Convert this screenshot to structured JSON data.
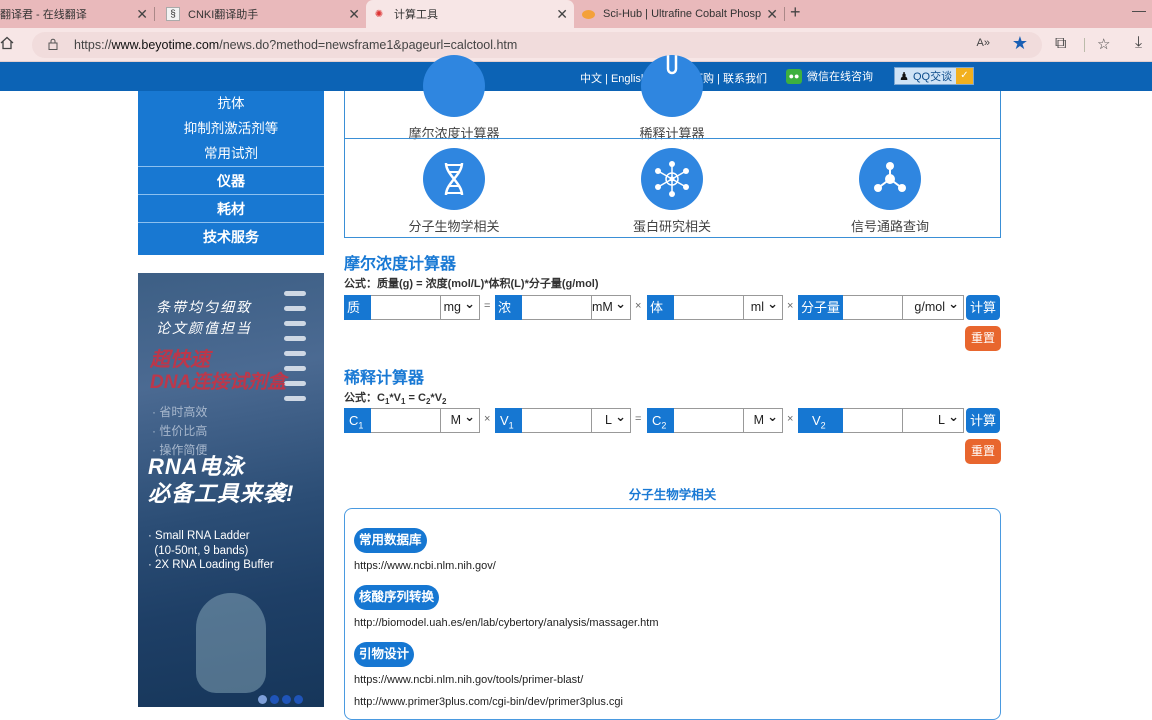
{
  "browser": {
    "tabs": [
      {
        "title": "翻译君 - 在线翻译",
        "active": false
      },
      {
        "title": "CNKI翻译助手",
        "active": false
      },
      {
        "title": "计算工具",
        "active": true
      },
      {
        "title": "Sci-Hub | Ultrafine Cobalt Phosp",
        "active": false
      }
    ],
    "url_prefix": "https://",
    "url_domain": "www.beyotime.com",
    "url_path": "/news.do?method=newsframe1&pageurl=calctool.htm",
    "read_aloud": "A»"
  },
  "topnav": {
    "lang": "中文 | English",
    "order": "快速订购 | 联系我们",
    "wechat": "微信在线咨询",
    "qq": "QQ交谈"
  },
  "sidebar": {
    "sub_items": [
      "抗体",
      "抑制剂激活剂等",
      "常用试剂"
    ],
    "main_items": [
      "仪器",
      "耗材",
      "技术服务"
    ]
  },
  "ad": {
    "line1": "条带均匀细致",
    "line2": "论文颜值担当",
    "headline1": "超快速",
    "headline2": "DNA连接试剂盒",
    "bullets": [
      "· 省时高效",
      "· 性价比高",
      "· 操作简便"
    ],
    "big1": "RNA电泳",
    "big2": "必备工具来袭!",
    "en1": "· Small RNA Ladder",
    "en2": "  (10-50nt, 9 bands)",
    "en3": "· 2X RNA Loading Buffer"
  },
  "categories": {
    "molar": "摩尔浓度计算器",
    "dilution": "稀释计算器",
    "molbio": "分子生物学相关",
    "protein": "蛋白研究相关",
    "signal": "信号通路查询"
  },
  "molar_calc": {
    "title": "摩尔浓度计算器",
    "formula": "公式：质量(g) = 浓度(mol/L)*体积(L)*分子量(g/mol)",
    "mass_label": "质量",
    "mass_unit": "mg",
    "conc_label": "浓度",
    "conc_unit": "mM",
    "vol_label": "体积",
    "vol_unit": "ml",
    "mw_label": "分子量",
    "mw_unit": "g/mol",
    "eq": "=",
    "times": "×",
    "calc_button": "计算",
    "reset_button": "重置"
  },
  "dilution_calc": {
    "title": "稀释计算器",
    "formula_prefix": "公式：",
    "c_unit": "M",
    "v_unit": "L",
    "calc_button": "计算",
    "reset_button": "重置"
  },
  "molbio_section": {
    "heading": "分子生物学相关",
    "groups": [
      {
        "title": "常用数据库",
        "links": [
          "https://www.ncbi.nlm.nih.gov/"
        ]
      },
      {
        "title": "核酸序列转换",
        "links": [
          "http://biomodel.uah.es/en/lab/cybertory/analysis/massager.htm"
        ]
      },
      {
        "title": "引物设计",
        "links": [
          "https://www.ncbi.nlm.nih.gov/tools/primer-blast/",
          "http://www.primer3plus.com/cgi-bin/dev/primer3plus.cgi"
        ]
      }
    ]
  }
}
